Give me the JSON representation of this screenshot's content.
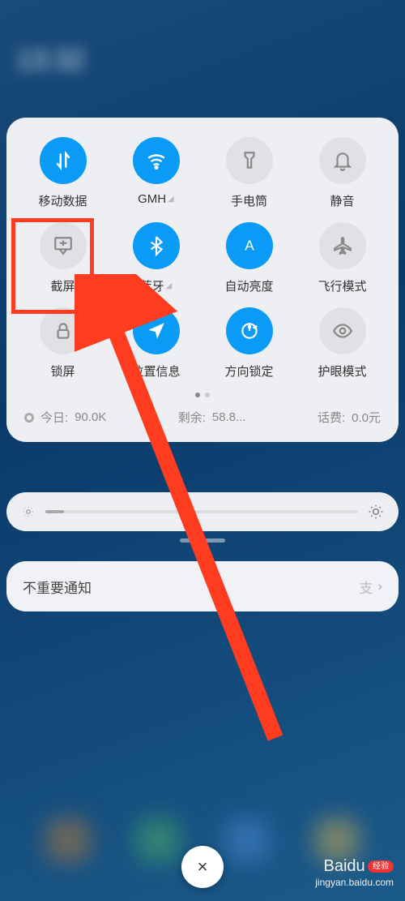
{
  "status": {
    "time": "13:32",
    "sub": "",
    "right": ""
  },
  "qs": {
    "items": [
      {
        "name": "mobile-data",
        "label": "移动数据",
        "active": true,
        "expandable": false
      },
      {
        "name": "wifi",
        "label": "GMH",
        "active": true,
        "expandable": true
      },
      {
        "name": "flashlight",
        "label": "手电筒",
        "active": false,
        "expandable": false
      },
      {
        "name": "mute",
        "label": "静音",
        "active": false,
        "expandable": false
      },
      {
        "name": "screenshot",
        "label": "截屏",
        "active": false,
        "expandable": false
      },
      {
        "name": "bluetooth",
        "label": "蓝牙",
        "active": true,
        "expandable": true
      },
      {
        "name": "auto-brightness",
        "label": "自动亮度",
        "active": true,
        "expandable": false
      },
      {
        "name": "airplane",
        "label": "飞行模式",
        "active": false,
        "expandable": false
      },
      {
        "name": "lock",
        "label": "锁屏",
        "active": false,
        "expandable": false
      },
      {
        "name": "location",
        "label": "位置信息",
        "active": true,
        "expandable": false
      },
      {
        "name": "rotation-lock",
        "label": "方向锁定",
        "active": true,
        "expandable": false
      },
      {
        "name": "eye-care",
        "label": "护眼模式",
        "active": false,
        "expandable": false
      }
    ],
    "footer": {
      "today_label": "今日:",
      "today_value": "90.0K",
      "remain_label": "剩余:",
      "remain_value": "58.8...",
      "bill_label": "话费:",
      "bill_value": "0.0元"
    }
  },
  "slider": {
    "percent": 6
  },
  "notif": {
    "title": "不重要通知",
    "icon": "支"
  },
  "close": {
    "label": "×"
  },
  "watermark": {
    "brand": "Baidu",
    "tag": "经验",
    "url": "jingyan.baidu.com"
  }
}
